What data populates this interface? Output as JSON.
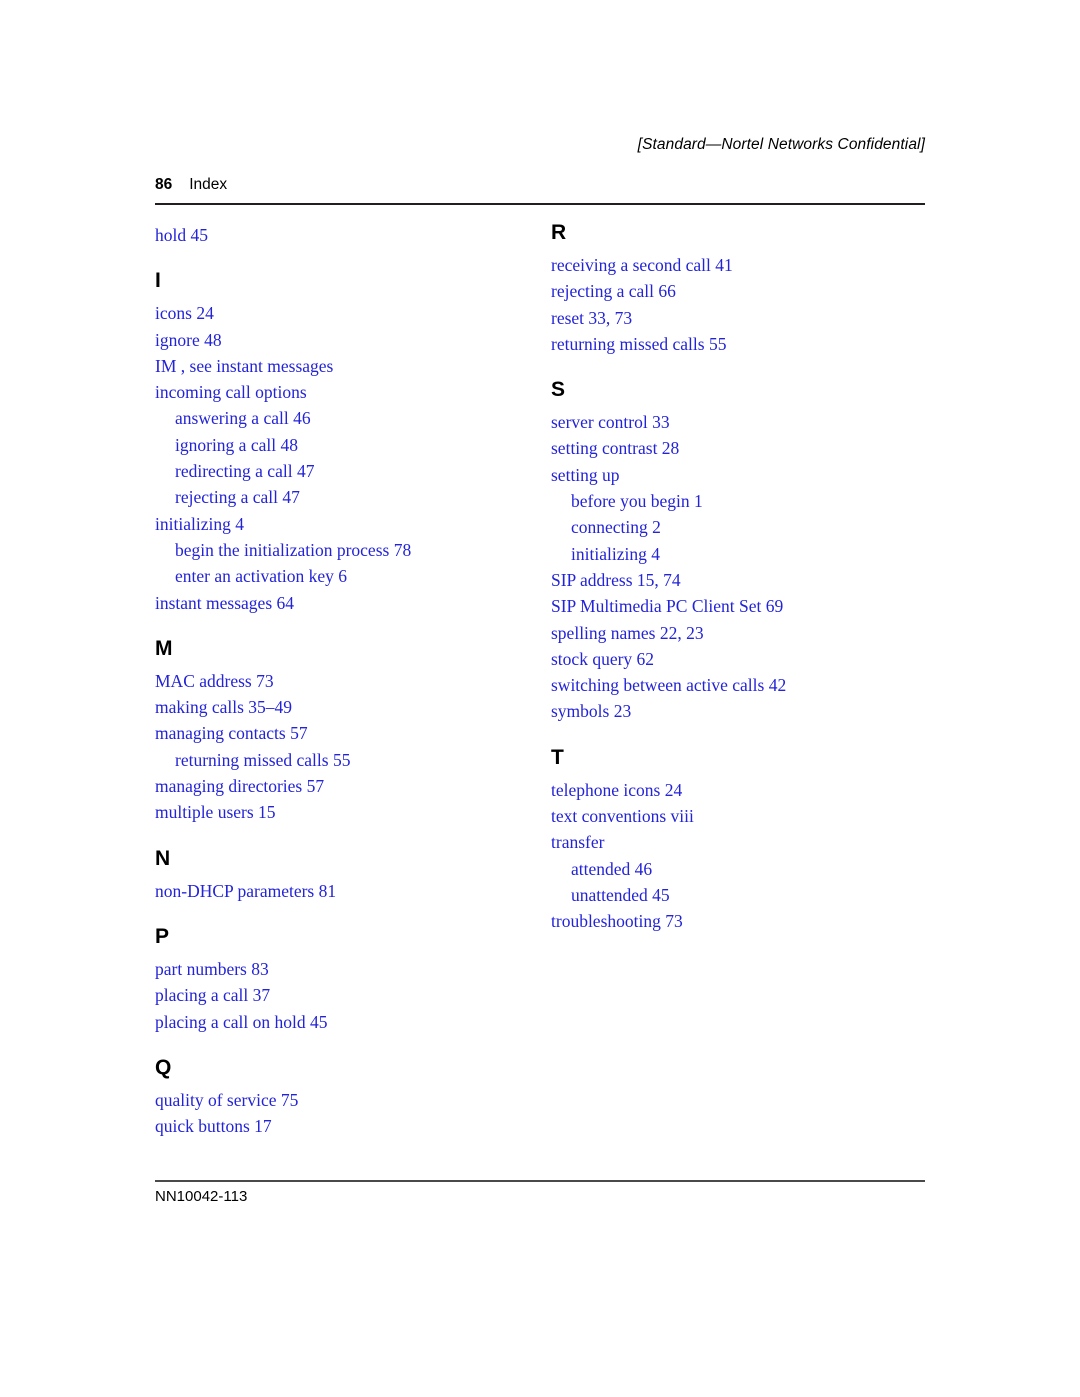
{
  "header": {
    "classification": "[Standard—Nortel Networks Confidential]",
    "folio": "86",
    "chapter": "Index"
  },
  "footer": {
    "document_code": "NN10042-113"
  },
  "colors": {
    "entry_link": "#2323d8",
    "heading": "#000000",
    "rule": "#231f20"
  },
  "index": {
    "left_column": [
      {
        "type": "entries",
        "items": [
          {
            "level": 1,
            "text": "hold 45"
          }
        ]
      },
      {
        "type": "section",
        "letter": "I",
        "items": [
          {
            "level": 1,
            "text": "icons 24"
          },
          {
            "level": 1,
            "text": "ignore 48"
          },
          {
            "level": 1,
            "text": "IM , see instant messages"
          },
          {
            "level": 1,
            "text": "incoming call options"
          },
          {
            "level": 2,
            "text": "answering a call 46"
          },
          {
            "level": 2,
            "text": "ignoring a call 48"
          },
          {
            "level": 2,
            "text": "redirecting a call 47"
          },
          {
            "level": 2,
            "text": "rejecting a call 47"
          },
          {
            "level": 1,
            "text": "initializing 4"
          },
          {
            "level": 2,
            "text": "begin the initialization process 78"
          },
          {
            "level": 2,
            "text": "enter an activation key 6"
          },
          {
            "level": 1,
            "text": "instant messages 64"
          }
        ]
      },
      {
        "type": "section",
        "letter": "M",
        "items": [
          {
            "level": 1,
            "text": "MAC address 73"
          },
          {
            "level": 1,
            "text": "making calls 35–49"
          },
          {
            "level": 1,
            "text": "managing contacts 57"
          },
          {
            "level": 2,
            "text": "returning missed calls 55"
          },
          {
            "level": 1,
            "text": "managing directories 57"
          },
          {
            "level": 1,
            "text": "multiple users 15"
          }
        ]
      },
      {
        "type": "section",
        "letter": "N",
        "items": [
          {
            "level": 1,
            "text": "non-DHCP parameters 81"
          }
        ]
      },
      {
        "type": "section",
        "letter": "P",
        "items": [
          {
            "level": 1,
            "text": "part numbers 83"
          },
          {
            "level": 1,
            "text": "placing a call 37"
          },
          {
            "level": 1,
            "text": "placing a call on hold 45"
          }
        ]
      },
      {
        "type": "section",
        "letter": "Q",
        "items": [
          {
            "level": 1,
            "text": "quality of service 75"
          },
          {
            "level": 1,
            "text": "quick buttons 17"
          }
        ]
      }
    ],
    "right_column": [
      {
        "type": "section",
        "letter": "R",
        "first": true,
        "items": [
          {
            "level": 1,
            "text": "receiving a second call 41"
          },
          {
            "level": 1,
            "text": "rejecting a call 66"
          },
          {
            "level": 1,
            "text": "reset 33, 73"
          },
          {
            "level": 1,
            "text": "returning missed calls 55"
          }
        ]
      },
      {
        "type": "section",
        "letter": "S",
        "items": [
          {
            "level": 1,
            "text": "server control 33"
          },
          {
            "level": 1,
            "text": "setting contrast 28"
          },
          {
            "level": 1,
            "text": "setting up"
          },
          {
            "level": 2,
            "text": "before you begin 1"
          },
          {
            "level": 2,
            "text": "connecting 2"
          },
          {
            "level": 2,
            "text": "initializing 4"
          },
          {
            "level": 1,
            "text": "SIP address 15, 74"
          },
          {
            "level": 1,
            "text": "SIP Multimedia PC Client Set 69"
          },
          {
            "level": 1,
            "text": "spelling names 22, 23"
          },
          {
            "level": 1,
            "text": "stock query 62"
          },
          {
            "level": 1,
            "text": "switching between active calls 42"
          },
          {
            "level": 1,
            "text": "symbols 23"
          }
        ]
      },
      {
        "type": "section",
        "letter": "T",
        "items": [
          {
            "level": 1,
            "text": "telephone icons 24"
          },
          {
            "level": 1,
            "text": "text conventions viii"
          },
          {
            "level": 1,
            "text": "transfer"
          },
          {
            "level": 2,
            "text": "attended 46"
          },
          {
            "level": 2,
            "text": "unattended 45"
          },
          {
            "level": 1,
            "text": "troubleshooting 73"
          }
        ]
      }
    ]
  }
}
